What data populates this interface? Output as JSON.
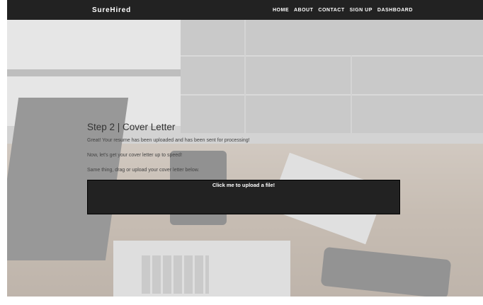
{
  "navbar": {
    "brand": "SureHired",
    "links": [
      "HOME",
      "ABOUT",
      "CONTACT",
      "SIGN UP",
      "DASHBOARD"
    ]
  },
  "main": {
    "title": "Step 2 | Cover Letter",
    "paragraphs": [
      "Great! Your resume has been uploaded and has been sent for processing!",
      "Now, let's get your cover letter up to speed!",
      "Same thing, drag or upload your cover letter below."
    ],
    "upload_label": "Click me to upload a file!"
  },
  "colors": {
    "navbar_bg": "#222222",
    "upload_bg": "#222222"
  }
}
